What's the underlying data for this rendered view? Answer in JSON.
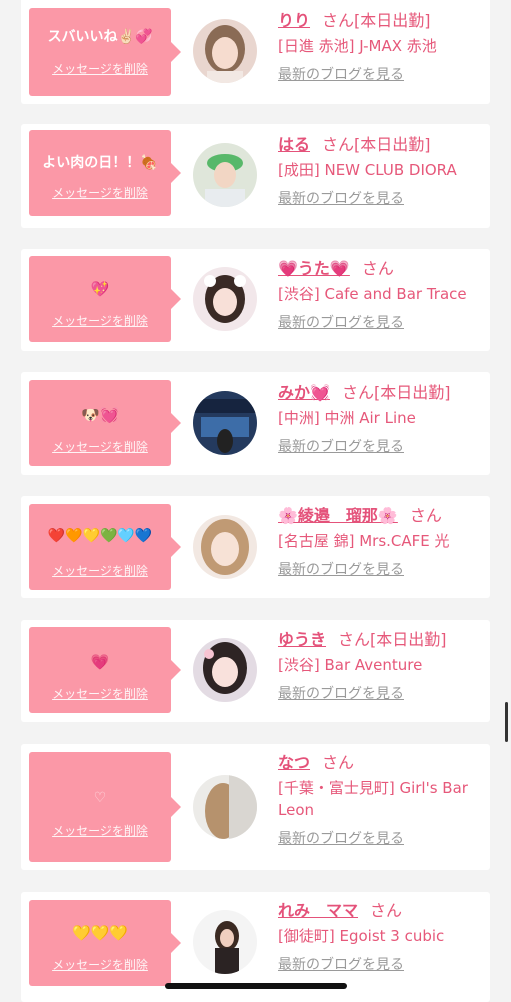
{
  "delete_label": "メッセージを削除",
  "blog_label": "最新のブログを見る",
  "san_label": "さん",
  "items": [
    {
      "message": "スバいいね✌🏻💞",
      "message_kind": "text",
      "name": "りり",
      "status": "[本日出勤]",
      "shop": "[日進 赤池] J-MAX 赤池"
    },
    {
      "message": "よい肉の日！！🍖",
      "message_kind": "text",
      "name": "はる",
      "status": "[本日出勤]",
      "shop": "[成田] NEW CLUB DIORA"
    },
    {
      "message": "💖",
      "message_kind": "emoji",
      "name": "💗うた💗",
      "status": "",
      "shop": "[渋谷] Cafe and Bar Trace"
    },
    {
      "message": "🐶💓",
      "message_kind": "emoji",
      "name": "みか💓",
      "status": "[本日出勤]",
      "shop": "[中洲] 中洲 Air Line"
    },
    {
      "message": "❤️🧡💛💚🩵💙",
      "message_kind": "emoji",
      "name": "🌸綾邉　瑠那🌸",
      "status": "",
      "shop": "[名古屋 錦] Mrs.CAFE 光"
    },
    {
      "message": "💗",
      "message_kind": "emoji",
      "name": "ゆうき",
      "status": "[本日出勤]",
      "shop": "[渋谷] Bar Aventure"
    },
    {
      "message": "♡",
      "message_kind": "faint",
      "name": "なつ",
      "status": "",
      "shop": "[千葉・富士見町] Girl's Bar Leon"
    },
    {
      "message": "💛💛💛",
      "message_kind": "emoji",
      "name": "れみ　ママ",
      "status": "",
      "shop": "[御徒町] Egoist 3 cubic"
    }
  ]
}
